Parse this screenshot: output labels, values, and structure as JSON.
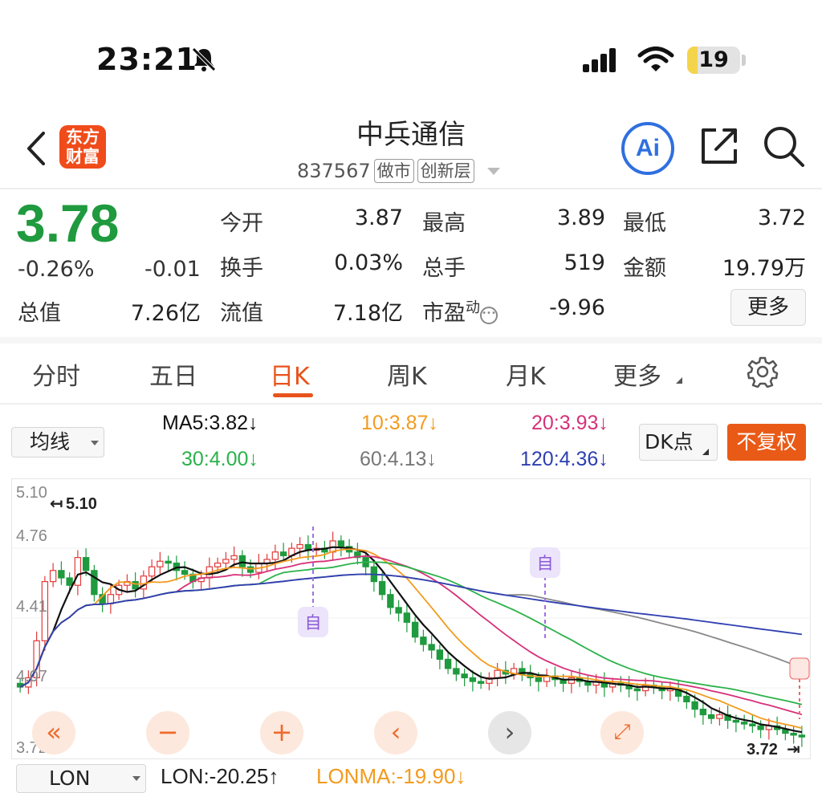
{
  "status_bar": {
    "time": "23:21",
    "battery": "19",
    "battery_percent": 19,
    "icons": [
      "bell-slash-icon",
      "cellular-signal-icon",
      "wifi-icon",
      "battery-icon"
    ]
  },
  "header": {
    "logo": {
      "line1": "东方",
      "line2": "财富"
    },
    "title": "中兵通信",
    "code": "837567",
    "tags": [
      "做市",
      "创新层"
    ],
    "ai_label": "Ai",
    "icons": [
      "back-arrow-icon",
      "ai-icon",
      "share-icon",
      "search-icon"
    ]
  },
  "quote": {
    "price": "3.78",
    "change_pct": "-0.26%",
    "change": "-0.01",
    "total_value_label": "总值",
    "total_value": "7.26亿",
    "fields": {
      "open": {
        "label": "今开",
        "value": "3.87"
      },
      "high": {
        "label": "最高",
        "value": "3.89"
      },
      "low": {
        "label": "最低",
        "value": "3.72"
      },
      "turnover_rate": {
        "label": "换手",
        "value": "0.03%"
      },
      "volume": {
        "label": "总手",
        "value": "519"
      },
      "amount": {
        "label": "金额",
        "value": "19.79万"
      },
      "float_value": {
        "label": "流值",
        "value": "7.18亿"
      },
      "pe": {
        "label": "市盈",
        "sup": "动",
        "value": "-9.96"
      }
    },
    "more": "更多",
    "colors": {
      "up": "#e23a3a",
      "down": "#1f9a3e"
    }
  },
  "tabs": {
    "items": [
      "分时",
      "五日",
      "日K",
      "周K",
      "月K",
      "更多"
    ],
    "active": "日K"
  },
  "ma_bar": {
    "selector": "均线",
    "ma5": "MA5:3.82↓",
    "ma10": "10:3.87↓",
    "ma20": "20:3.93↓",
    "ma30": "30:4.00↓",
    "ma60": "60:4.13↓",
    "ma120": "120:4.36↓",
    "dk": "DK点",
    "adjust": "不复权",
    "colors": {
      "ma5": "#111111",
      "ma10": "#f29b1e",
      "ma20": "#d6317a",
      "ma30": "#2bb24a",
      "ma60": "#888888",
      "ma120": "#2f3fb0"
    }
  },
  "chart": {
    "y_ticks": [
      "5.10",
      "4.76",
      "4.41",
      "4.07",
      "3.72"
    ],
    "high_marker": "5.10",
    "low_marker": "3.72",
    "marker_label": "自",
    "controls": [
      "double-left-icon",
      "zoom-out-icon",
      "zoom-in-icon",
      "prev-icon",
      "next-icon",
      "fullscreen-icon"
    ]
  },
  "chart_data": {
    "type": "candlestick",
    "ylim": [
      3.72,
      5.1
    ],
    "close": [
      4.05,
      4.1,
      4.3,
      4.62,
      4.68,
      4.64,
      4.6,
      4.75,
      4.68,
      4.55,
      4.5,
      4.55,
      4.6,
      4.62,
      4.58,
      4.65,
      4.7,
      4.73,
      4.72,
      4.68,
      4.66,
      4.62,
      4.64,
      4.7,
      4.72,
      4.74,
      4.76,
      4.7,
      4.67,
      4.72,
      4.74,
      4.78,
      4.76,
      4.8,
      4.82,
      4.79,
      4.8,
      4.78,
      4.84,
      4.81,
      4.78,
      4.75,
      4.7,
      4.62,
      4.55,
      4.48,
      4.45,
      4.4,
      4.32,
      4.28,
      4.25,
      4.2,
      4.15,
      4.12,
      4.1,
      4.08,
      4.07,
      4.1,
      4.14,
      4.12,
      4.15,
      4.12,
      4.1,
      4.08,
      4.11,
      4.09,
      4.07,
      4.1,
      4.08,
      4.06,
      4.08,
      4.05,
      4.07,
      4.06,
      4.04,
      4.03,
      4.06,
      4.05,
      4.03,
      4.04,
      4.0,
      3.97,
      3.93,
      3.9,
      3.88,
      3.9,
      3.87,
      3.86,
      3.85,
      3.84,
      3.82,
      3.84,
      3.82,
      3.8,
      3.79,
      3.78
    ],
    "ma": {
      "MA5": 3.82,
      "MA10": 3.87,
      "MA20": 3.93,
      "MA30": 4.0,
      "MA60": 4.13,
      "MA120": 4.36
    }
  },
  "indicator": {
    "selector": "LON",
    "lon": "LON:-20.25↑",
    "lonma": "LONMA:-19.90↓",
    "colors": {
      "lon": "#222222",
      "lonma": "#f29b1e"
    }
  }
}
